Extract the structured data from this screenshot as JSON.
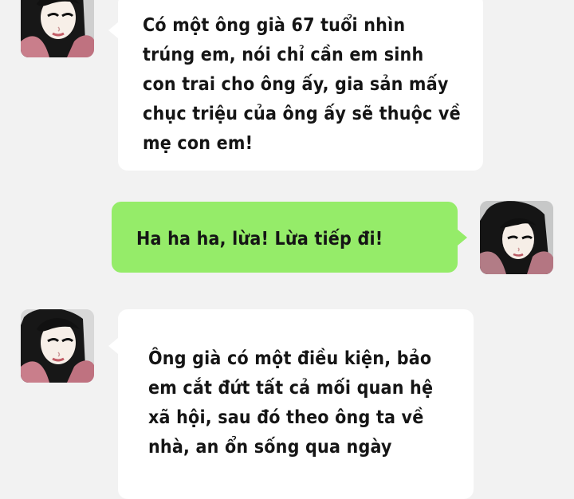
{
  "chat": {
    "messages": [
      {
        "sender": "contact",
        "text": "Có một ông già 67 tuổi nhìn trúng em, nói chỉ cần em sinh con trai cho ông ấy, gia sản mấy chục triệu của ông ấy sẽ thuộc về mẹ con em!"
      },
      {
        "sender": "me",
        "text": "Ha ha ha, lừa! Lừa tiếp đi!"
      },
      {
        "sender": "contact",
        "text": "Ông già có một điều kiện, bảo em cắt đứt tất cả mối quan hệ xã hội, sau đó theo ông ta về nhà, an ổn sống qua ngày"
      }
    ]
  },
  "colors": {
    "background": "#f2f2f2",
    "incoming_bubble": "#ffffff",
    "outgoing_bubble": "#95ec69"
  },
  "icons": {
    "contact_avatar": "contact-avatar",
    "my_avatar": "my-avatar"
  }
}
